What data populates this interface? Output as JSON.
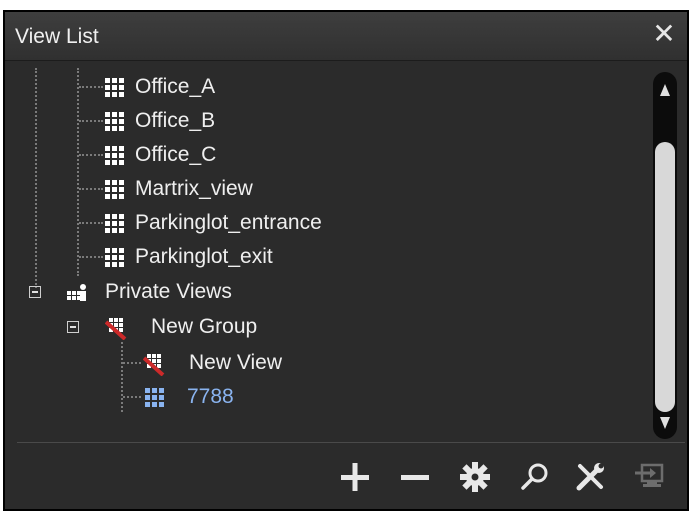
{
  "window": {
    "title": "View List",
    "close_label": "✕"
  },
  "tree": {
    "shared_views": [
      {
        "label": "Office_A",
        "icon": "grid-view-icon"
      },
      {
        "label": "Office_B",
        "icon": "grid-view-icon"
      },
      {
        "label": "Office_C",
        "icon": "grid-view-icon"
      },
      {
        "label": "Martrix_view",
        "icon": "grid-view-icon"
      },
      {
        "label": "Parkinglot_entrance",
        "icon": "grid-view-icon"
      },
      {
        "label": "Parkinglot_exit",
        "icon": "grid-view-icon"
      }
    ],
    "private_views": {
      "label": "Private Views",
      "icon": "private-views-icon",
      "group": {
        "label": "New Group",
        "icon": "group-disabled-icon",
        "children": [
          {
            "label": "New View",
            "icon": "view-disabled-icon"
          },
          {
            "label": "7788",
            "icon": "grid-view-selected-icon",
            "color": "#8ab4f0"
          }
        ]
      }
    }
  },
  "toolbar": {
    "buttons": [
      {
        "name": "add-button",
        "icon": "plus-icon"
      },
      {
        "name": "remove-button",
        "icon": "minus-icon"
      },
      {
        "name": "settings-button",
        "icon": "gear-icon"
      },
      {
        "name": "search-button",
        "icon": "search-icon"
      },
      {
        "name": "tools-button",
        "icon": "tools-icon"
      },
      {
        "name": "export-button",
        "icon": "export-icon",
        "disabled": true
      }
    ]
  },
  "colors": {
    "panel_bg": "#2b2b2b",
    "text": "#efefef",
    "selected_text": "#8ab4f0",
    "grid_icon": "#ffffff",
    "disabled_accent": "#cc2a2a"
  }
}
